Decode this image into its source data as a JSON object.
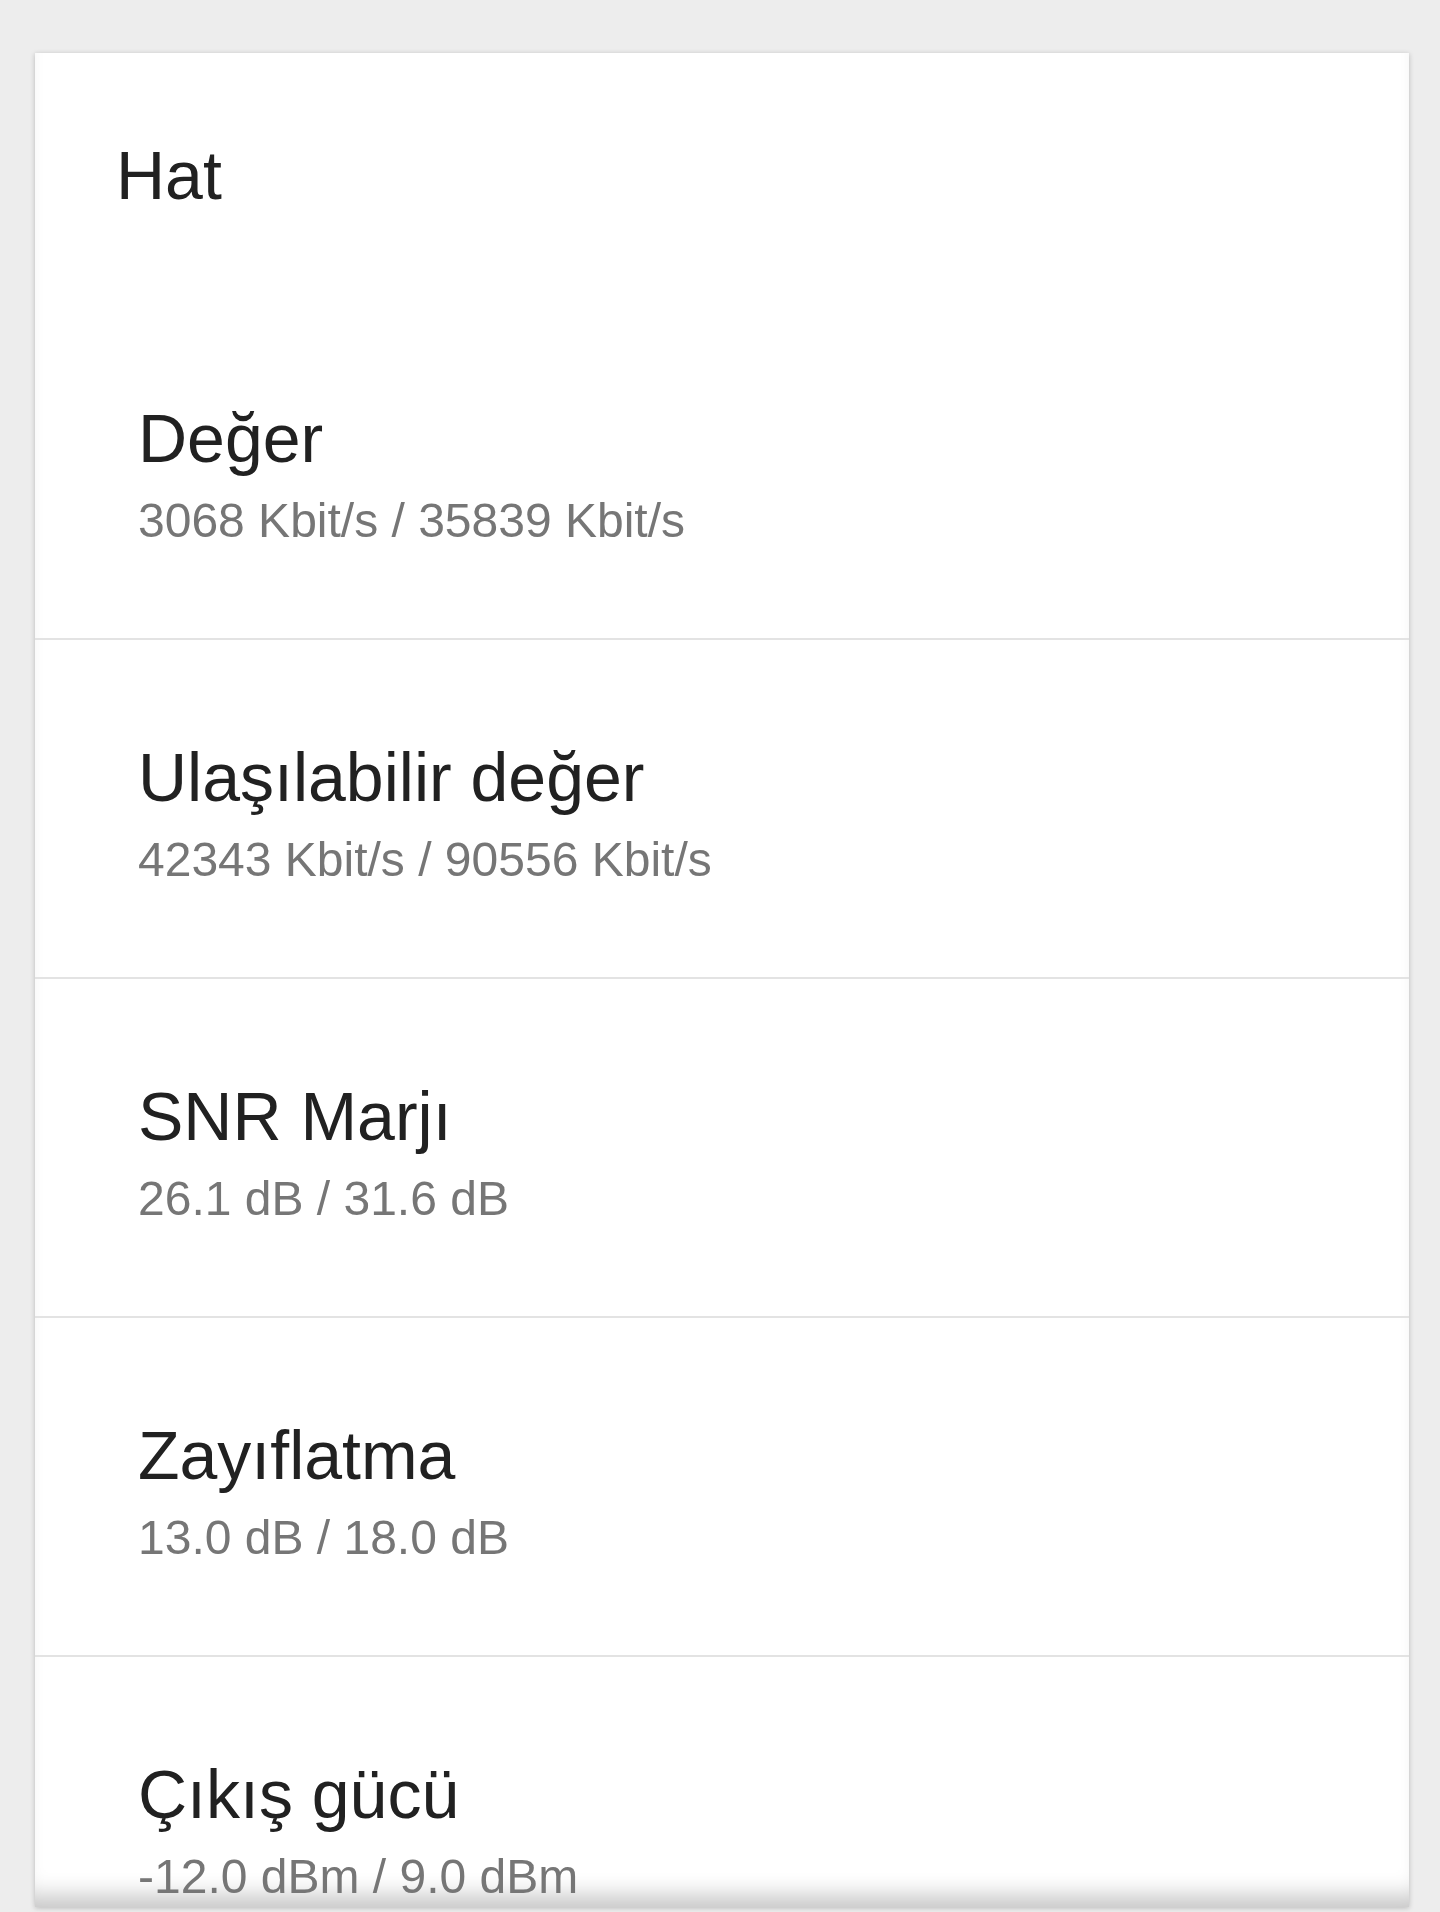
{
  "section": {
    "title": "Hat",
    "items": [
      {
        "title": "Değer",
        "value": "3068 Kbit/s / 35839 Kbit/s"
      },
      {
        "title": "Ulaşılabilir değer",
        "value": "42343 Kbit/s / 90556 Kbit/s"
      },
      {
        "title": "SNR Marjı",
        "value": "26.1 dB / 31.6 dB"
      },
      {
        "title": "Zayıflatma",
        "value": "13.0 dB / 18.0 dB"
      },
      {
        "title": "Çıkış gücü",
        "value": "-12.0 dBm / 9.0 dBm"
      }
    ]
  }
}
